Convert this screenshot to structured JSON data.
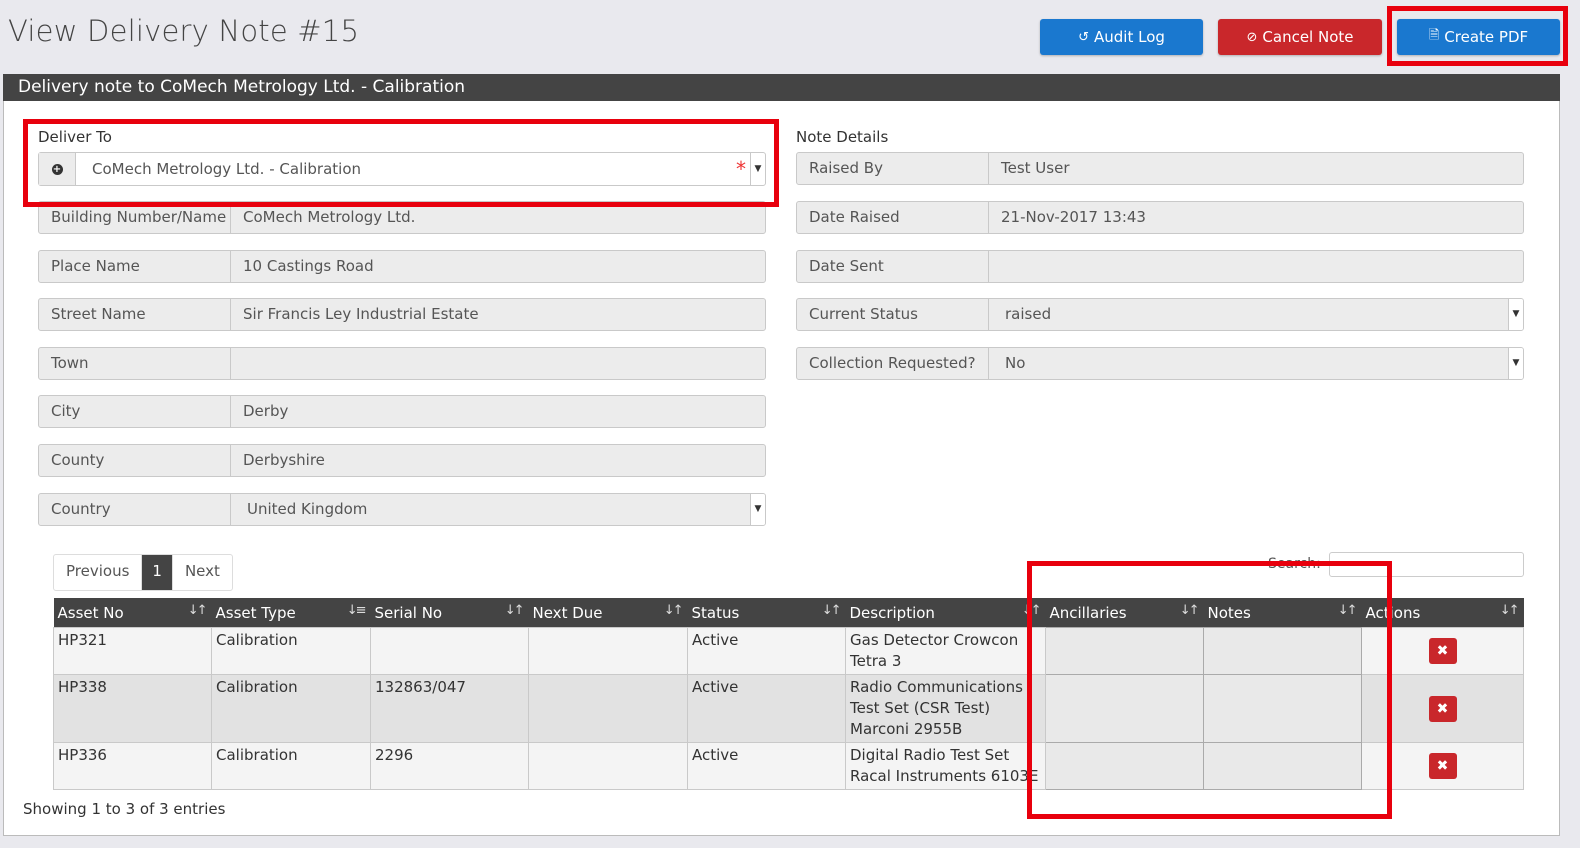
{
  "page": {
    "title": "View Delivery Note #15"
  },
  "toolbar": {
    "audit_label": "Audit Log",
    "cancel_label": "Cancel Note",
    "pdf_label": "Create PDF"
  },
  "card": {
    "header": "Delivery note to CoMech Metrology Ltd. - Calibration"
  },
  "deliver": {
    "section_label": "Deliver To",
    "selected": "CoMech Metrology Ltd. - Calibration",
    "required_mark": "*",
    "fields": [
      {
        "label": "Building Number/Name",
        "value": "CoMech Metrology Ltd."
      },
      {
        "label": "Place Name",
        "value": "10 Castings Road"
      },
      {
        "label": "Street Name",
        "value": "Sir Francis Ley Industrial Estate"
      },
      {
        "label": "Town",
        "value": ""
      },
      {
        "label": "City",
        "value": "Derby"
      },
      {
        "label": "County",
        "value": "Derbyshire"
      },
      {
        "label": "Country",
        "value": "United Kingdom"
      }
    ]
  },
  "note": {
    "section_label": "Note Details",
    "fields": [
      {
        "label": "Raised By",
        "value": "Test User"
      },
      {
        "label": "Date Raised",
        "value": "21-Nov-2017 13:43"
      },
      {
        "label": "Date Sent",
        "value": ""
      },
      {
        "label": "Current Status",
        "value": "raised"
      },
      {
        "label": "Collection Requested?",
        "value": "No"
      }
    ]
  },
  "pager": {
    "prev": "Previous",
    "page": "1",
    "next": "Next"
  },
  "search": {
    "label": "Search:"
  },
  "table": {
    "columns": [
      "Asset No",
      "Asset Type",
      "Serial No",
      "Next Due",
      "Status",
      "Description",
      "Ancillaries",
      "Notes",
      "Actions"
    ],
    "rows": [
      {
        "asset_no": "HP321",
        "type": "Calibration",
        "serial": "",
        "next_due": "",
        "status": "Active",
        "description": "Gas Detector Crowcon Tetra 3"
      },
      {
        "asset_no": "HP338",
        "type": "Calibration",
        "serial": "132863/047",
        "next_due": "",
        "status": "Active",
        "description": "Radio Communications Test Set (CSR Test) Marconi 2955B"
      },
      {
        "asset_no": "HP336",
        "type": "Calibration",
        "serial": "2296",
        "next_due": "",
        "status": "Active",
        "description": "Digital Radio Test Set Racal Instruments 6103E"
      }
    ]
  },
  "footer": {
    "info": "Showing 1 to 3 of 3 entries"
  },
  "icons": {
    "audit": "history-icon",
    "cancel": "ban-icon",
    "pdf": "file-pdf-icon",
    "delete": "times-icon",
    "add": "plus-circle-icon",
    "sort": "sort-icon"
  },
  "colors": {
    "primary": "#1a78cf",
    "danger": "#c9272b",
    "header": "#444444",
    "highlight": "#e8000d"
  }
}
